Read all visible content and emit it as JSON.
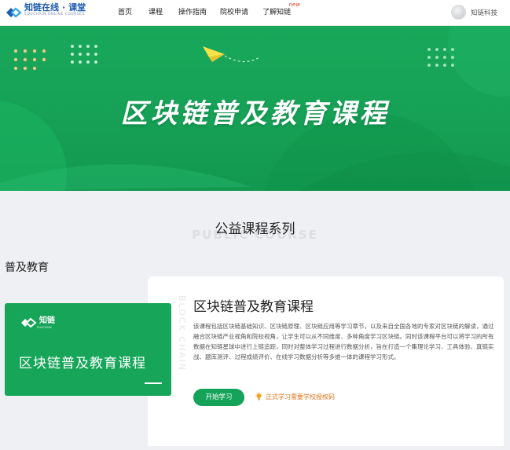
{
  "header": {
    "logo_main": "知链在线",
    "logo_dot": "·",
    "logo_tail": "课堂",
    "logo_sub": "EDUCHAIN ONLINE COURSES",
    "nav": [
      {
        "label": "首页"
      },
      {
        "label": "课程"
      },
      {
        "label": "操作指南"
      },
      {
        "label": "院校申请"
      },
      {
        "label": "了解知链",
        "badge": "new"
      }
    ],
    "user_name": "知链科技"
  },
  "banner": {
    "title": "区块链普及教育课程",
    "icons": [
      "paper-plane-icon",
      "dot-grid-icon"
    ]
  },
  "section": {
    "title": "公益课程系列",
    "subtitle": "PUBLIC COURSE",
    "category": "普及教育"
  },
  "course": {
    "vertical_text": "BLOCK CHAIN",
    "cover_logo": "知链",
    "cover_logo_sub": "EDUCHAIN",
    "cover_title": "区块链普及教育课程",
    "title": "区块链普及教育课程",
    "description": "该课程包括区块链基础知识、区块链原理、区块链应用等学习章节，以及来自全国各地的专家对区块链的解读，通过融合区块链产业视角和院校视角，让学生可以从不同维度、多种角度学习区块链。同时该课程平台可以将学习的所有数据在知链星球中进行上链追踪，同时对整体学习过程进行数据分析，旨在打造一个集理论学习、工具体验、真链实战、题库测评、过程成绩评价、在线学习数据分析等多维一体的课程学习形式。",
    "start_label": "开始学习",
    "auth_note": "正式学习需要学校授权码"
  },
  "colors": {
    "brand_green": "#16a156",
    "logo_blue": "#1e5bb0",
    "badge_red": "#e8412e",
    "note_orange": "#e0731a"
  }
}
